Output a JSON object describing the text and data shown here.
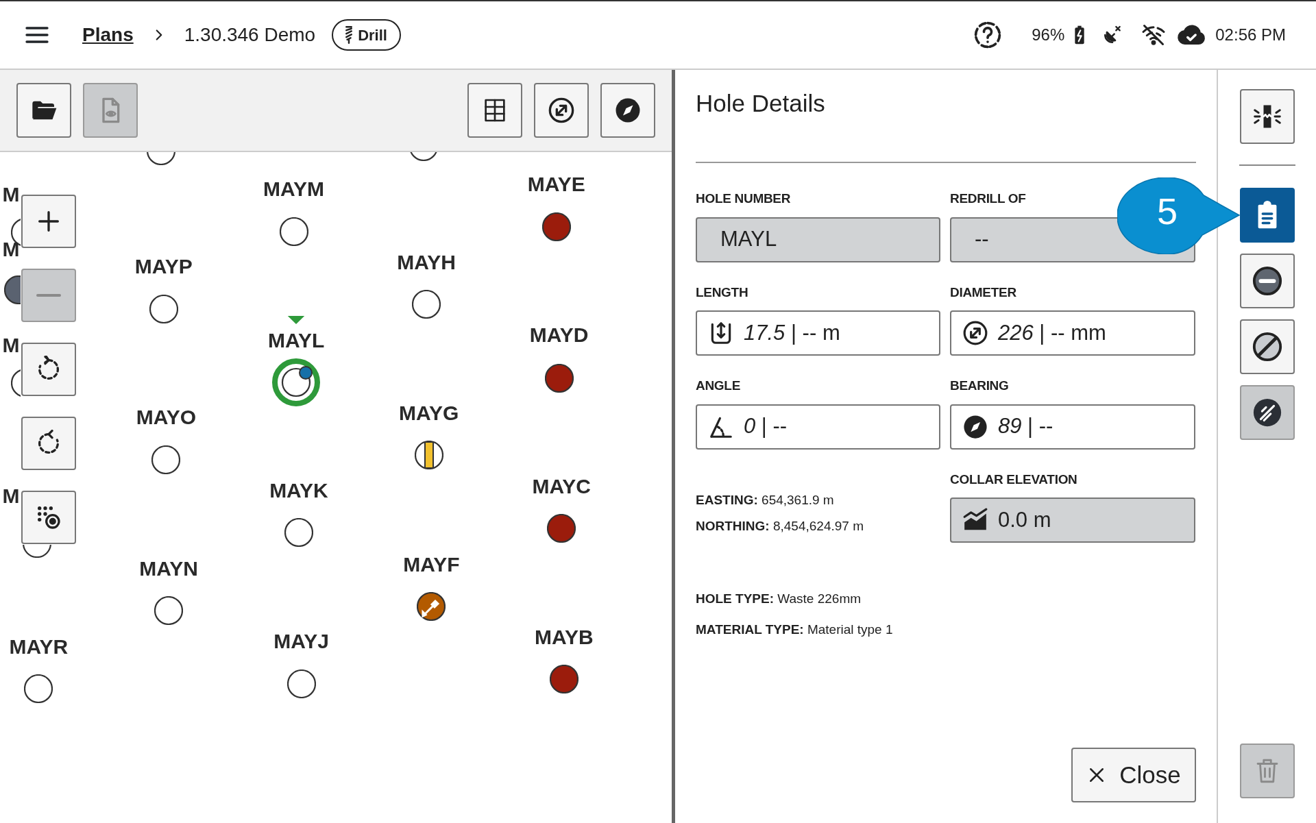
{
  "top_bar": {
    "breadcrumb": [
      {
        "label": "Plans",
        "link": true
      },
      {
        "label": "1.30.346 Demo",
        "link": false
      }
    ],
    "mode_badge": "Drill",
    "battery": "96%",
    "time": "02:56 PM"
  },
  "map_toolbar": [
    {
      "kind": "folder",
      "disabled": false
    },
    {
      "kind": "document",
      "disabled": true
    },
    {
      "kind": "grid",
      "disabled": false
    },
    {
      "kind": "diameter",
      "disabled": false
    },
    {
      "kind": "compass",
      "disabled": false
    }
  ],
  "map_controls": [
    {
      "kind": "zoom-in",
      "disabled": false
    },
    {
      "kind": "zoom-out",
      "disabled": true
    },
    {
      "kind": "rotate-right",
      "disabled": false
    },
    {
      "kind": "rotate-left",
      "disabled": false
    },
    {
      "kind": "pattern",
      "disabled": false
    }
  ],
  "holes": [
    {
      "kind": "empty",
      "selected": false
    },
    {
      "kind": "empty",
      "selected": false
    },
    {
      "label": "MAYE",
      "kind": "drilled",
      "selected": false
    },
    {
      "label": "M",
      "kind": "empty",
      "selected": false
    },
    {
      "label": "MAYM",
      "kind": "empty",
      "selected": false
    },
    {
      "label": "M",
      "kind": "dark",
      "selected": false
    },
    {
      "label": "MAYP",
      "kind": "empty",
      "selected": false
    },
    {
      "label": "MAYH",
      "kind": "empty",
      "selected": false
    },
    {
      "label": "MAYL",
      "kind": "tagged",
      "selected": true
    },
    {
      "label": "MAYD",
      "kind": "drilled",
      "selected": false
    },
    {
      "label": "M",
      "kind": "empty",
      "selected": false
    },
    {
      "label": "MAYO",
      "kind": "empty",
      "selected": false
    },
    {
      "label": "MAYG",
      "kind": "split",
      "selected": false
    },
    {
      "label": "MAYK",
      "kind": "empty",
      "selected": false
    },
    {
      "label": "MAYC",
      "kind": "drilled",
      "selected": false
    },
    {
      "label": "M",
      "kind": "empty",
      "selected": false
    },
    {
      "label": "MAYN",
      "kind": "empty",
      "selected": false
    },
    {
      "label": "MAYF",
      "kind": "shovel",
      "selected": false
    },
    {
      "label": "MAYR",
      "kind": "empty",
      "selected": false
    },
    {
      "label": "MAYJ",
      "kind": "empty",
      "selected": false
    },
    {
      "label": "MAYB",
      "kind": "drilled",
      "selected": false
    }
  ],
  "details": {
    "title": "Hole Details",
    "fields": [
      {
        "label": "HOLE NUMBER",
        "value": "MAYL",
        "kind": "text",
        "readonly": true
      },
      {
        "label": "REDRILL OF",
        "value": "--",
        "kind": "text",
        "readonly": true
      },
      {
        "label": "LENGTH",
        "value": "*17.5* | -- m",
        "kind": "length",
        "readonly": false
      },
      {
        "label": "DIAMETER",
        "value": "*226* | -- mm",
        "kind": "diameter",
        "readonly": false
      },
      {
        "label": "ANGLE",
        "value": "*0* | --",
        "kind": "angle",
        "readonly": false
      },
      {
        "label": "BEARING",
        "value": "*89* | --",
        "kind": "bearing",
        "readonly": false
      },
      {
        "label": "COLLAR ELEVATION",
        "value": "0.0 m",
        "kind": "elevation",
        "readonly": true
      }
    ],
    "coordinates": [
      {
        "label": "EASTING:",
        "value": "654,361.9 m"
      },
      {
        "label": "NORTHING:",
        "value": "8,454,624.97 m"
      }
    ],
    "attributes": [
      {
        "label": "HOLE TYPE:",
        "value": "Waste 226mm"
      },
      {
        "label": "MATERIAL TYPE:",
        "value": "Material type 1"
      }
    ],
    "close_button": "Close"
  },
  "side_tools": {
    "top": {
      "kind": "focus",
      "disabled": false
    },
    "items": [
      {
        "kind": "notes",
        "selected": true,
        "disabled": false
      },
      {
        "kind": "minus",
        "selected": false,
        "disabled": false
      },
      {
        "kind": "slash",
        "selected": false,
        "disabled": false
      },
      {
        "kind": "slash-dark",
        "selected": false,
        "disabled": true
      }
    ],
    "delete": {
      "kind": "trash",
      "disabled": true
    }
  },
  "callout": {
    "text": "5"
  }
}
